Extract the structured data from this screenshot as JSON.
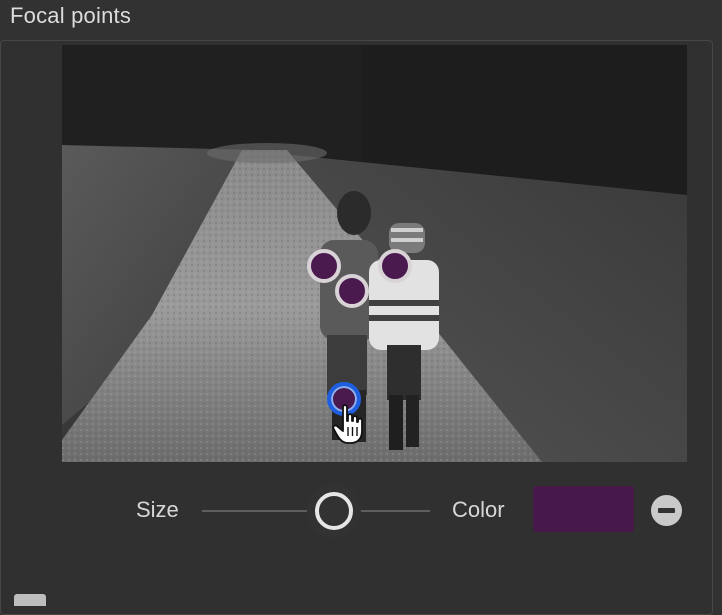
{
  "panel": {
    "title": "Focal points"
  },
  "focal_points": {
    "fill_color": "#4a1a4f",
    "ring_color": "#d9d3d8",
    "active_ring_color": "#1d5fe0",
    "count": 4
  },
  "controls": {
    "size_label": "Size",
    "size_value": 0.58,
    "color_label": "Color",
    "color_value": "#46194a",
    "remove_icon": "minus-circle-icon"
  }
}
